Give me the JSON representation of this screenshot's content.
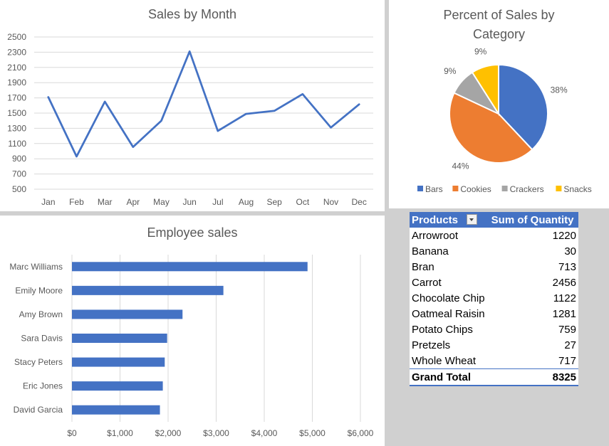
{
  "line_chart": {
    "title": "Sales by Month"
  },
  "pie_chart": {
    "title_line1": "Percent of Sales by",
    "title_line2": "Category"
  },
  "bar_chart": {
    "title": "Employee sales"
  },
  "pivot": {
    "header_products": "Products",
    "header_quantity": "Sum of Quantity",
    "rows": [
      {
        "product": "Arrowroot",
        "quantity": "1220"
      },
      {
        "product": "Banana",
        "quantity": "30"
      },
      {
        "product": "Bran",
        "quantity": "713"
      },
      {
        "product": "Carrot",
        "quantity": "2456"
      },
      {
        "product": "Chocolate Chip",
        "quantity": "1122"
      },
      {
        "product": "Oatmeal Raisin",
        "quantity": "1281"
      },
      {
        "product": "Potato Chips",
        "quantity": "759"
      },
      {
        "product": "Pretzels",
        "quantity": "27"
      },
      {
        "product": "Whole Wheat",
        "quantity": "717"
      }
    ],
    "total_label": "Grand Total",
    "total_value": "8325"
  },
  "colors": {
    "series_blue": "#4472c4",
    "orange": "#ed7d31",
    "gray": "#a5a5a5",
    "yellow": "#ffc000",
    "grid": "#d9d9d9",
    "axis_text": "#595959"
  },
  "chart_data": [
    {
      "type": "line",
      "title": "Sales by Month",
      "categories": [
        "Jan",
        "Feb",
        "Mar",
        "Apr",
        "May",
        "Jun",
        "Jul",
        "Aug",
        "Sep",
        "Oct",
        "Nov",
        "Dec"
      ],
      "values": [
        1710,
        930,
        1650,
        1055,
        1400,
        2310,
        1265,
        1490,
        1530,
        1750,
        1310,
        1615
      ],
      "ylim": [
        500,
        2500
      ],
      "yticks": [
        "500",
        "700",
        "900",
        "1100",
        "1300",
        "1500",
        "1700",
        "1900",
        "2100",
        "2300",
        "2500"
      ],
      "grid": true
    },
    {
      "type": "pie",
      "title": "Percent of Sales by Category",
      "labels": [
        "Bars",
        "Cookies",
        "Crackers",
        "Snacks"
      ],
      "values": [
        38,
        44,
        9,
        9
      ],
      "value_labels": [
        "38%",
        "44%",
        "9%",
        "9%"
      ],
      "legend": "bottom"
    },
    {
      "type": "bar",
      "title": "Employee sales",
      "orientation": "horizontal",
      "categories": [
        "Marc Williams",
        "Emily Moore",
        "Amy Brown",
        "Sara Davis",
        "Stacy Peters",
        "Eric Jones",
        "David Garcia"
      ],
      "values": [
        4900,
        3150,
        2300,
        1980,
        1930,
        1890,
        1830
      ],
      "xlim": [
        0,
        6000
      ],
      "xticks": [
        "$0",
        "$1,000",
        "$2,000",
        "$3,000",
        "$4,000",
        "$5,000",
        "$6,000"
      ],
      "grid": true
    }
  ]
}
